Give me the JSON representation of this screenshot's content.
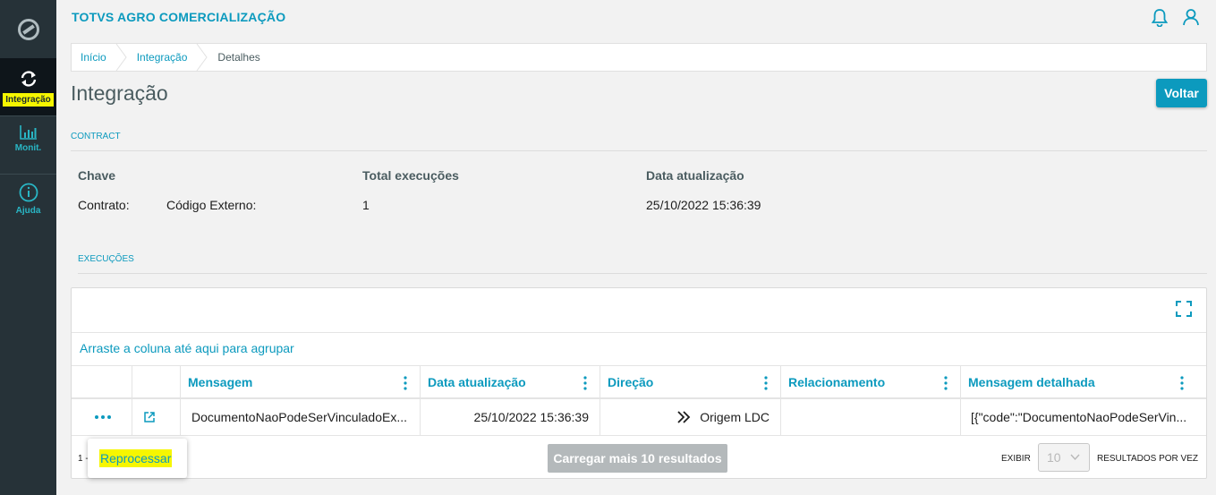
{
  "sidebar": {
    "items": [
      {
        "label": "Integração",
        "icon": "sync-icon",
        "active": true
      },
      {
        "label": "Monit.",
        "icon": "bar-chart-icon"
      },
      {
        "label": "Ajuda",
        "icon": "info-icon"
      }
    ]
  },
  "header": {
    "app_title": "TOTVS AGRO COMERCIALIZAÇÃO",
    "icons": [
      "bell-icon",
      "user-icon"
    ]
  },
  "breadcrumb": [
    "Início",
    "Integração",
    "Detalhes"
  ],
  "page": {
    "title": "Integração",
    "back_button": "Voltar"
  },
  "contract": {
    "section_label": "CONTRACT",
    "headers": {
      "key": "Chave",
      "total": "Total execuções",
      "updated": "Data atualização"
    },
    "contract_label": "Contrato:",
    "external_code_label": "Código Externo:",
    "total_value": "1",
    "updated_value": "25/10/2022 15:36:39"
  },
  "executions": {
    "section_label": "EXECUÇÕES",
    "group_hint": "Arraste a coluna até aqui para agrupar",
    "columns": [
      "Mensagem",
      "Data atualização",
      "Direção",
      "Relacionamento",
      "Mensagem detalhada"
    ],
    "rows": [
      {
        "mensagem": "DocumentoNaoPodeSerVinculadoEx...",
        "data": "25/10/2022 15:36:39",
        "direcao": "Origem LDC",
        "relacionamento": "",
        "detalhada": "[{\"code\":\"DocumentoNaoPodeSerVin..."
      }
    ],
    "footer_count": "1 -",
    "load_more": "Carregar mais 10 resultados",
    "exibir_label": "EXIBIR",
    "page_size": "10",
    "per_page_label": "RESULTADOS POR VEZ",
    "row_popup_action": "Reprocessar"
  },
  "colors": {
    "primary": "#0c9abe",
    "sidebar": "#263238",
    "highlight": "#f6f600",
    "disabled_button": "#b4b9bb"
  }
}
